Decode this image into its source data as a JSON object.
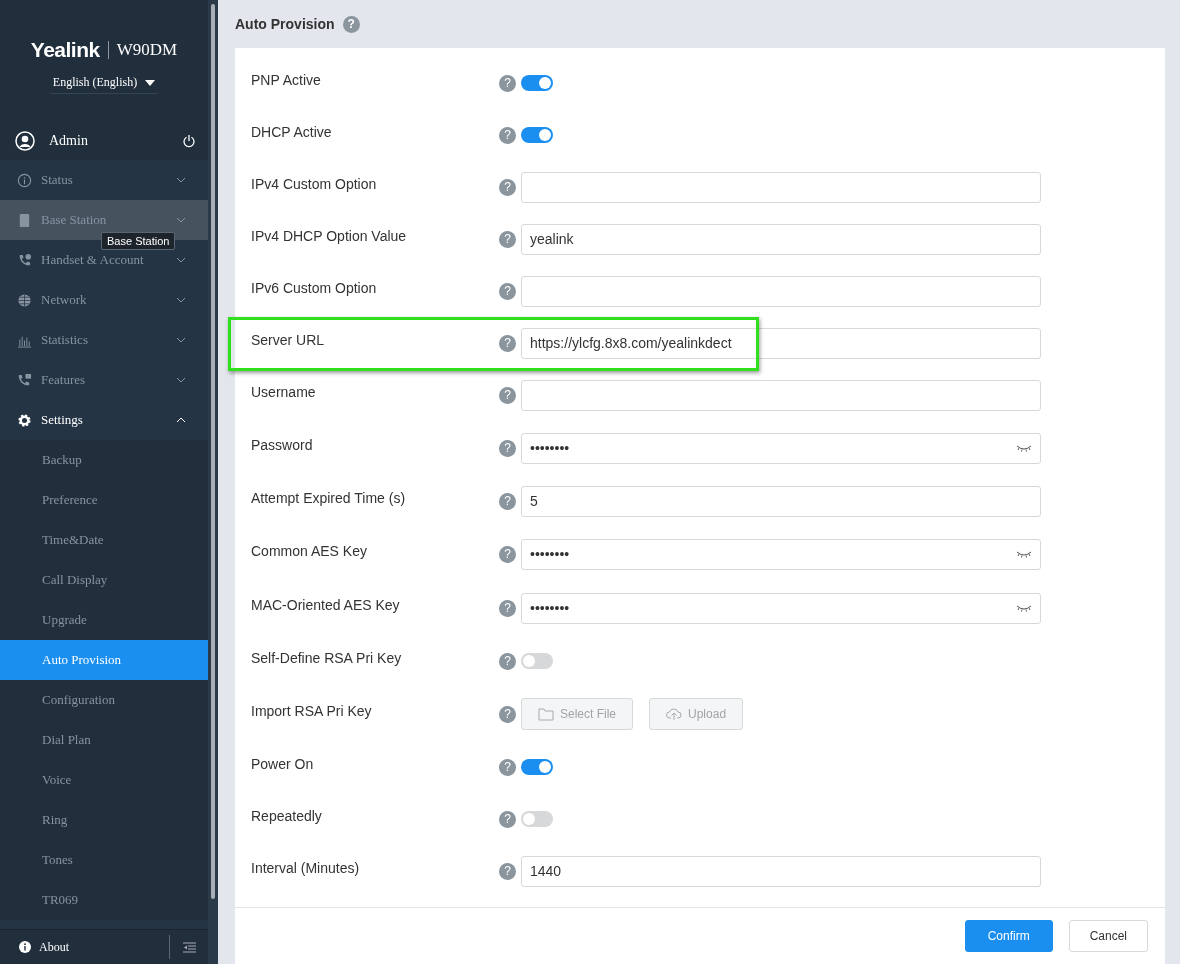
{
  "sidebar": {
    "brand": "Yealink",
    "model": "W90DM",
    "language": "English (English)",
    "user": "Admin",
    "items": [
      {
        "label": "Status",
        "hovered": false,
        "expanded": false
      },
      {
        "label": "Base Station",
        "hovered": true,
        "expanded": false
      },
      {
        "label": "Handset & Account",
        "hovered": false,
        "expanded": false
      },
      {
        "label": "Network",
        "hovered": false,
        "expanded": false
      },
      {
        "label": "Statistics",
        "hovered": false,
        "expanded": false
      },
      {
        "label": "Features",
        "hovered": false,
        "expanded": false
      },
      {
        "label": "Settings",
        "hovered": false,
        "expanded": true,
        "children": [
          {
            "label": "Backup",
            "selected": false
          },
          {
            "label": "Preference",
            "selected": false
          },
          {
            "label": "Time&Date",
            "selected": false
          },
          {
            "label": "Call Display",
            "selected": false
          },
          {
            "label": "Upgrade",
            "selected": false
          },
          {
            "label": "Auto Provision",
            "selected": true
          },
          {
            "label": "Configuration",
            "selected": false
          },
          {
            "label": "Dial Plan",
            "selected": false
          },
          {
            "label": "Voice",
            "selected": false
          },
          {
            "label": "Ring",
            "selected": false
          },
          {
            "label": "Tones",
            "selected": false
          },
          {
            "label": "TR069",
            "selected": false
          }
        ]
      }
    ],
    "tooltip": "Base Station",
    "about": "About"
  },
  "page": {
    "title": "Auto Provision",
    "help": "?",
    "rows": [
      {
        "label": "PNP Active",
        "help": "?",
        "kind": "toggle",
        "on": true,
        "highlighted": false
      },
      {
        "label": "DHCP Active",
        "help": "?",
        "kind": "toggle",
        "on": true,
        "highlighted": false
      },
      {
        "label": "IPv4 Custom Option",
        "help": "?",
        "kind": "text",
        "value": "",
        "highlighted": false
      },
      {
        "label": "IPv4 DHCP Option Value",
        "help": "?",
        "kind": "text",
        "value": "yealink",
        "highlighted": false
      },
      {
        "label": "IPv6 Custom Option",
        "help": "?",
        "kind": "text",
        "value": "",
        "highlighted": false
      },
      {
        "label": "Server URL",
        "help": "?",
        "kind": "text",
        "value": "https://ylcfg.8x8.com/yealinkdect",
        "highlighted": true
      },
      {
        "label": "Username",
        "help": "?",
        "kind": "text",
        "value": "",
        "highlighted": false
      },
      {
        "label": "Password",
        "help": "?",
        "kind": "password",
        "value": "••••••••",
        "highlighted": false
      },
      {
        "label": "Attempt Expired Time (s)",
        "help": "?",
        "kind": "text",
        "value": "5",
        "highlighted": false
      },
      {
        "label": "Common AES Key",
        "help": "?",
        "kind": "password",
        "value": "••••••••",
        "highlighted": false
      },
      {
        "label": "MAC-Oriented AES Key",
        "help": "?",
        "kind": "password",
        "value": "••••••••",
        "highlighted": false
      },
      {
        "label": "Self-Define RSA Pri Key",
        "help": "?",
        "kind": "toggle",
        "on": false,
        "highlighted": false
      },
      {
        "label": "Import RSA Pri Key",
        "help": "?",
        "kind": "file",
        "buttons": [
          "Select File",
          "Upload"
        ],
        "highlighted": false
      },
      {
        "label": "Power On",
        "help": "?",
        "kind": "toggle",
        "on": true,
        "highlighted": false
      },
      {
        "label": "Repeatedly",
        "help": "?",
        "kind": "toggle",
        "on": false,
        "highlighted": false
      },
      {
        "label": "Interval (Minutes)",
        "help": "?",
        "kind": "text",
        "value": "1440",
        "highlighted": false
      }
    ],
    "buttons": [
      {
        "label": "Confirm",
        "kind": "primary"
      },
      {
        "label": "Cancel",
        "kind": "default"
      }
    ]
  }
}
